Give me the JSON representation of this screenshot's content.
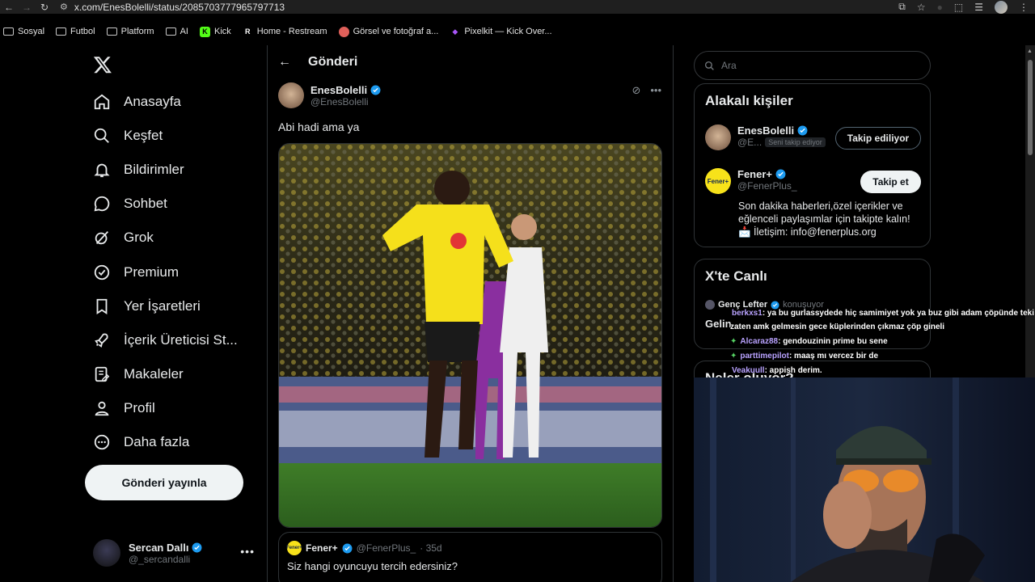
{
  "browser": {
    "url": "x.com/EnesBolelli/status/2085703777965797713",
    "bookmarks": [
      {
        "label": "Sosyal",
        "icon": "folder-icon"
      },
      {
        "label": "Futbol",
        "icon": "folder-icon"
      },
      {
        "label": "Platform",
        "icon": "folder-icon"
      },
      {
        "label": "AI",
        "icon": "folder-icon"
      },
      {
        "label": "Kick",
        "icon": "kick-icon",
        "color": "#53fc18"
      },
      {
        "label": "Home - Restream",
        "icon": "restream-icon",
        "color": "#ffffff"
      },
      {
        "label": "Görsel ve fotoğraf a...",
        "icon": "photo-site-icon",
        "color": "#e0605a"
      },
      {
        "label": "Pixelkit — Kick Over...",
        "icon": "pixelkit-icon",
        "color": "#a855f7"
      }
    ]
  },
  "sidebar": {
    "items": [
      {
        "label": "Anasayfa",
        "icon": "home-icon"
      },
      {
        "label": "Keşfet",
        "icon": "search-icon"
      },
      {
        "label": "Bildirimler",
        "icon": "bell-icon"
      },
      {
        "label": "Sohbet",
        "icon": "chat-icon"
      },
      {
        "label": "Grok",
        "icon": "grok-icon"
      },
      {
        "label": "Premium",
        "icon": "premium-icon"
      },
      {
        "label": "Yer İşaretleri",
        "icon": "bookmark-icon"
      },
      {
        "label": "İçerik Üreticisi St...",
        "icon": "rocket-icon"
      },
      {
        "label": "Makaleler",
        "icon": "article-icon"
      },
      {
        "label": "Profil",
        "icon": "person-icon"
      },
      {
        "label": "Daha fazla",
        "icon": "more-circle-icon"
      }
    ],
    "post_button": "Gönderi yayınla",
    "account": {
      "name": "Sercan Dallı",
      "handle": "@_sercandalli"
    }
  },
  "main": {
    "title": "Gönderi",
    "tweet": {
      "author_name": "EnesBolelli",
      "author_handle": "@EnesBolelli",
      "text": "Abi hadi ama ya",
      "image_alt": "Borussia Dortmund oyuncusu gol sevinci yapıyor",
      "jersey_sponsor": "vodafone"
    },
    "quote": {
      "name": "Fener+",
      "handle": "@FenerPlus_",
      "age": "· 35d",
      "text": "Siz hangi oyuncuyu tercih edersiniz?",
      "avatar_text": "Fener+"
    }
  },
  "right": {
    "search_placeholder": "Ara",
    "related_title": "Alakalı kişiler",
    "people": [
      {
        "name": "EnesBolelli",
        "handle": "@E...",
        "badge": "Seni takip ediyor",
        "button": "Takip ediliyor"
      },
      {
        "name": "Fener+",
        "handle": "@FenerPlus_",
        "button": "Takip et",
        "avatar_text": "Fener+",
        "bio_lines": [
          "Son dakika haberleri,özel içerikler ve",
          "eğlenceli paylaşımlar için takipte kalın!",
          "📩 İletişim: info@fenerplus.org"
        ]
      }
    ],
    "live_title": "X'te Canlı",
    "live_item": {
      "name": "Genç Lefter",
      "status": "konuşuyor",
      "text": "Gelin"
    },
    "next_title": "Neler oluyor?"
  },
  "chat": [
    {
      "user": "berkxs1",
      "text": ": ya bu gurlassydede hiç samimiyet yok ya buz gibi adam çöpünde teki",
      "badge": false
    },
    {
      "user": "",
      "text": "zaten amk gelmesin gece küplerinden çıkmaz çöp gineli",
      "badge": false
    },
    {
      "user": "Alcaraz88",
      "text": ": gendouzinin prime bu sene",
      "badge": true
    },
    {
      "user": "parttimepilot",
      "text": ": maaş mı vercez bir de",
      "badge": true
    },
    {
      "user": "Veakuull",
      "text": ": appish derim.",
      "badge": false
    }
  ],
  "colors": {
    "verified": "#1d9bf0",
    "background": "#000000",
    "border": "#2f3336",
    "muted": "#71767b",
    "dortmund_yellow": "#f5e01b"
  }
}
